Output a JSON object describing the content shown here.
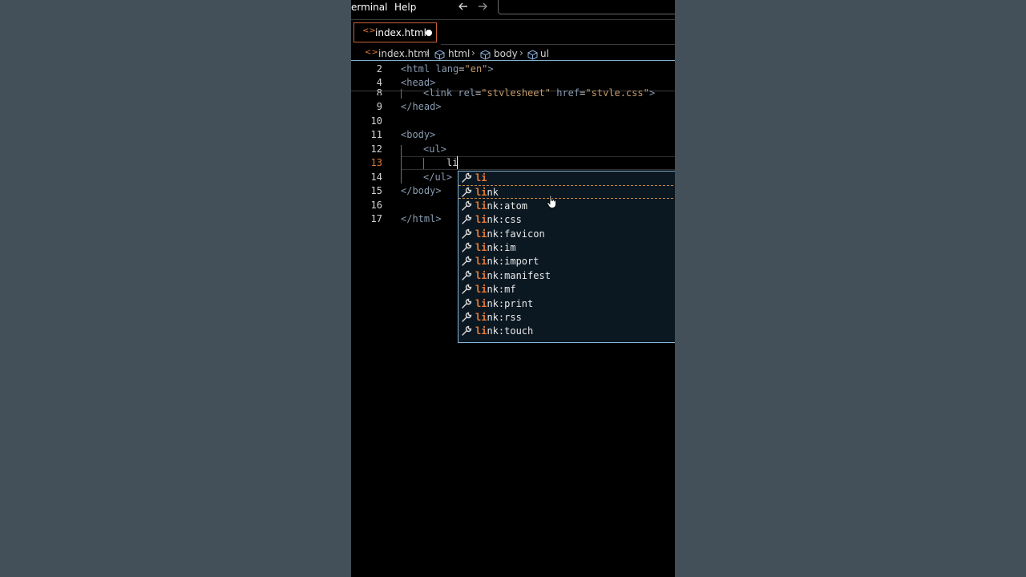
{
  "menubar": {
    "items": [
      "erminal",
      "Help"
    ],
    "back_icon": "arrow-left-icon",
    "forward_icon": "arrow-right-icon"
  },
  "tab": {
    "label": "index.html",
    "icon": "html-file-icon",
    "dirty": true
  },
  "breadcrumb": {
    "file": "index.html",
    "items": [
      "html",
      "body",
      "ul"
    ]
  },
  "code": {
    "lines": [
      {
        "num": "2",
        "text": "<html lang=\"en\">"
      },
      {
        "num": "4",
        "text": "<head>"
      },
      {
        "num": "8",
        "text": "<link rel=\"stylesheet\" href=\"style.css\">"
      },
      {
        "num": "9",
        "text": "</head>"
      },
      {
        "num": "10",
        "text": ""
      },
      {
        "num": "11",
        "text": "<body>"
      },
      {
        "num": "12",
        "text": "<ul>"
      },
      {
        "num": "13",
        "text": "li"
      },
      {
        "num": "14",
        "text": "</ul>"
      },
      {
        "num": "15",
        "text": "</body>"
      },
      {
        "num": "16",
        "text": ""
      },
      {
        "num": "17",
        "text": "</html>"
      }
    ],
    "active_line": "13"
  },
  "suggest": {
    "typed": "li",
    "selected_index": 1,
    "items": [
      {
        "match": "li",
        "rest": ""
      },
      {
        "match": "li",
        "rest": "nk"
      },
      {
        "match": "li",
        "rest": "nk:atom"
      },
      {
        "match": "li",
        "rest": "nk:css"
      },
      {
        "match": "li",
        "rest": "nk:favicon"
      },
      {
        "match": "li",
        "rest": "nk:im"
      },
      {
        "match": "li",
        "rest": "nk:import"
      },
      {
        "match": "li",
        "rest": "nk:manifest"
      },
      {
        "match": "li",
        "rest": "nk:mf"
      },
      {
        "match": "li",
        "rest": "nk:print"
      },
      {
        "match": "li",
        "rest": "nk:rss"
      },
      {
        "match": "li",
        "rest": "nk:touch"
      }
    ],
    "item_icon": "wrench-icon"
  },
  "colors": {
    "accent": "#e37933",
    "background": "#000000",
    "outer_background": "#43505a",
    "suggest_border": "#8ab8d8"
  }
}
